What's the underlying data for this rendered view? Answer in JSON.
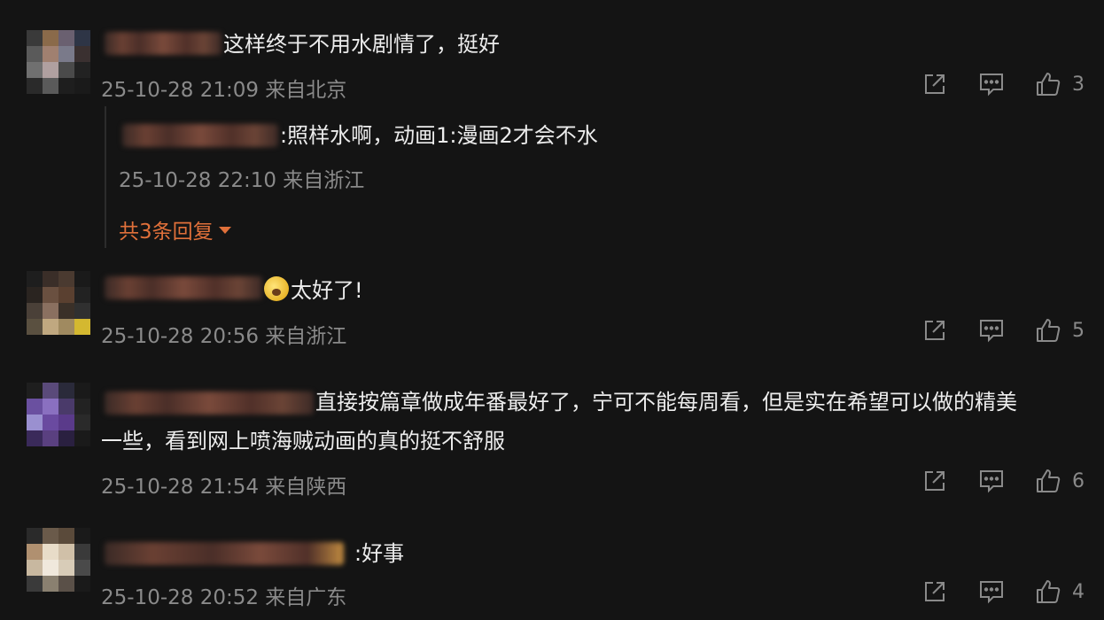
{
  "comments": [
    {
      "text": "这样终于不用水剧情了，挺好",
      "meta": "25-10-28 21:09 来自北京",
      "likes": "3",
      "replies": [
        {
          "text": ":照样水啊，动画1:漫画2才会不水",
          "meta": "25-10-28 22:10 来自浙江"
        }
      ],
      "more_replies": "共3条回复"
    },
    {
      "text": "太好了!",
      "emoji": "grinning-face-emoji",
      "meta": "25-10-28 20:56 来自浙江",
      "likes": "5"
    },
    {
      "text_line1": "直接按篇章做成年番最好了，宁可不能每周看，但是实在希望可以做的精美",
      "text_line2": "一些，看到网上喷海贼动画的真的挺不舒服",
      "meta": "25-10-28 21:54 来自陕西",
      "likes": "6"
    },
    {
      "text": ":好事",
      "meta": "25-10-28 20:52 来自广东",
      "likes": "4"
    }
  ],
  "icons": {
    "share": "share-icon",
    "reply": "comment-icon",
    "like": "thumbs-up-icon"
  },
  "colors": {
    "background": "#141414",
    "text": "#ececec",
    "meta": "#8a8a8a",
    "accent": "#e0703a"
  }
}
